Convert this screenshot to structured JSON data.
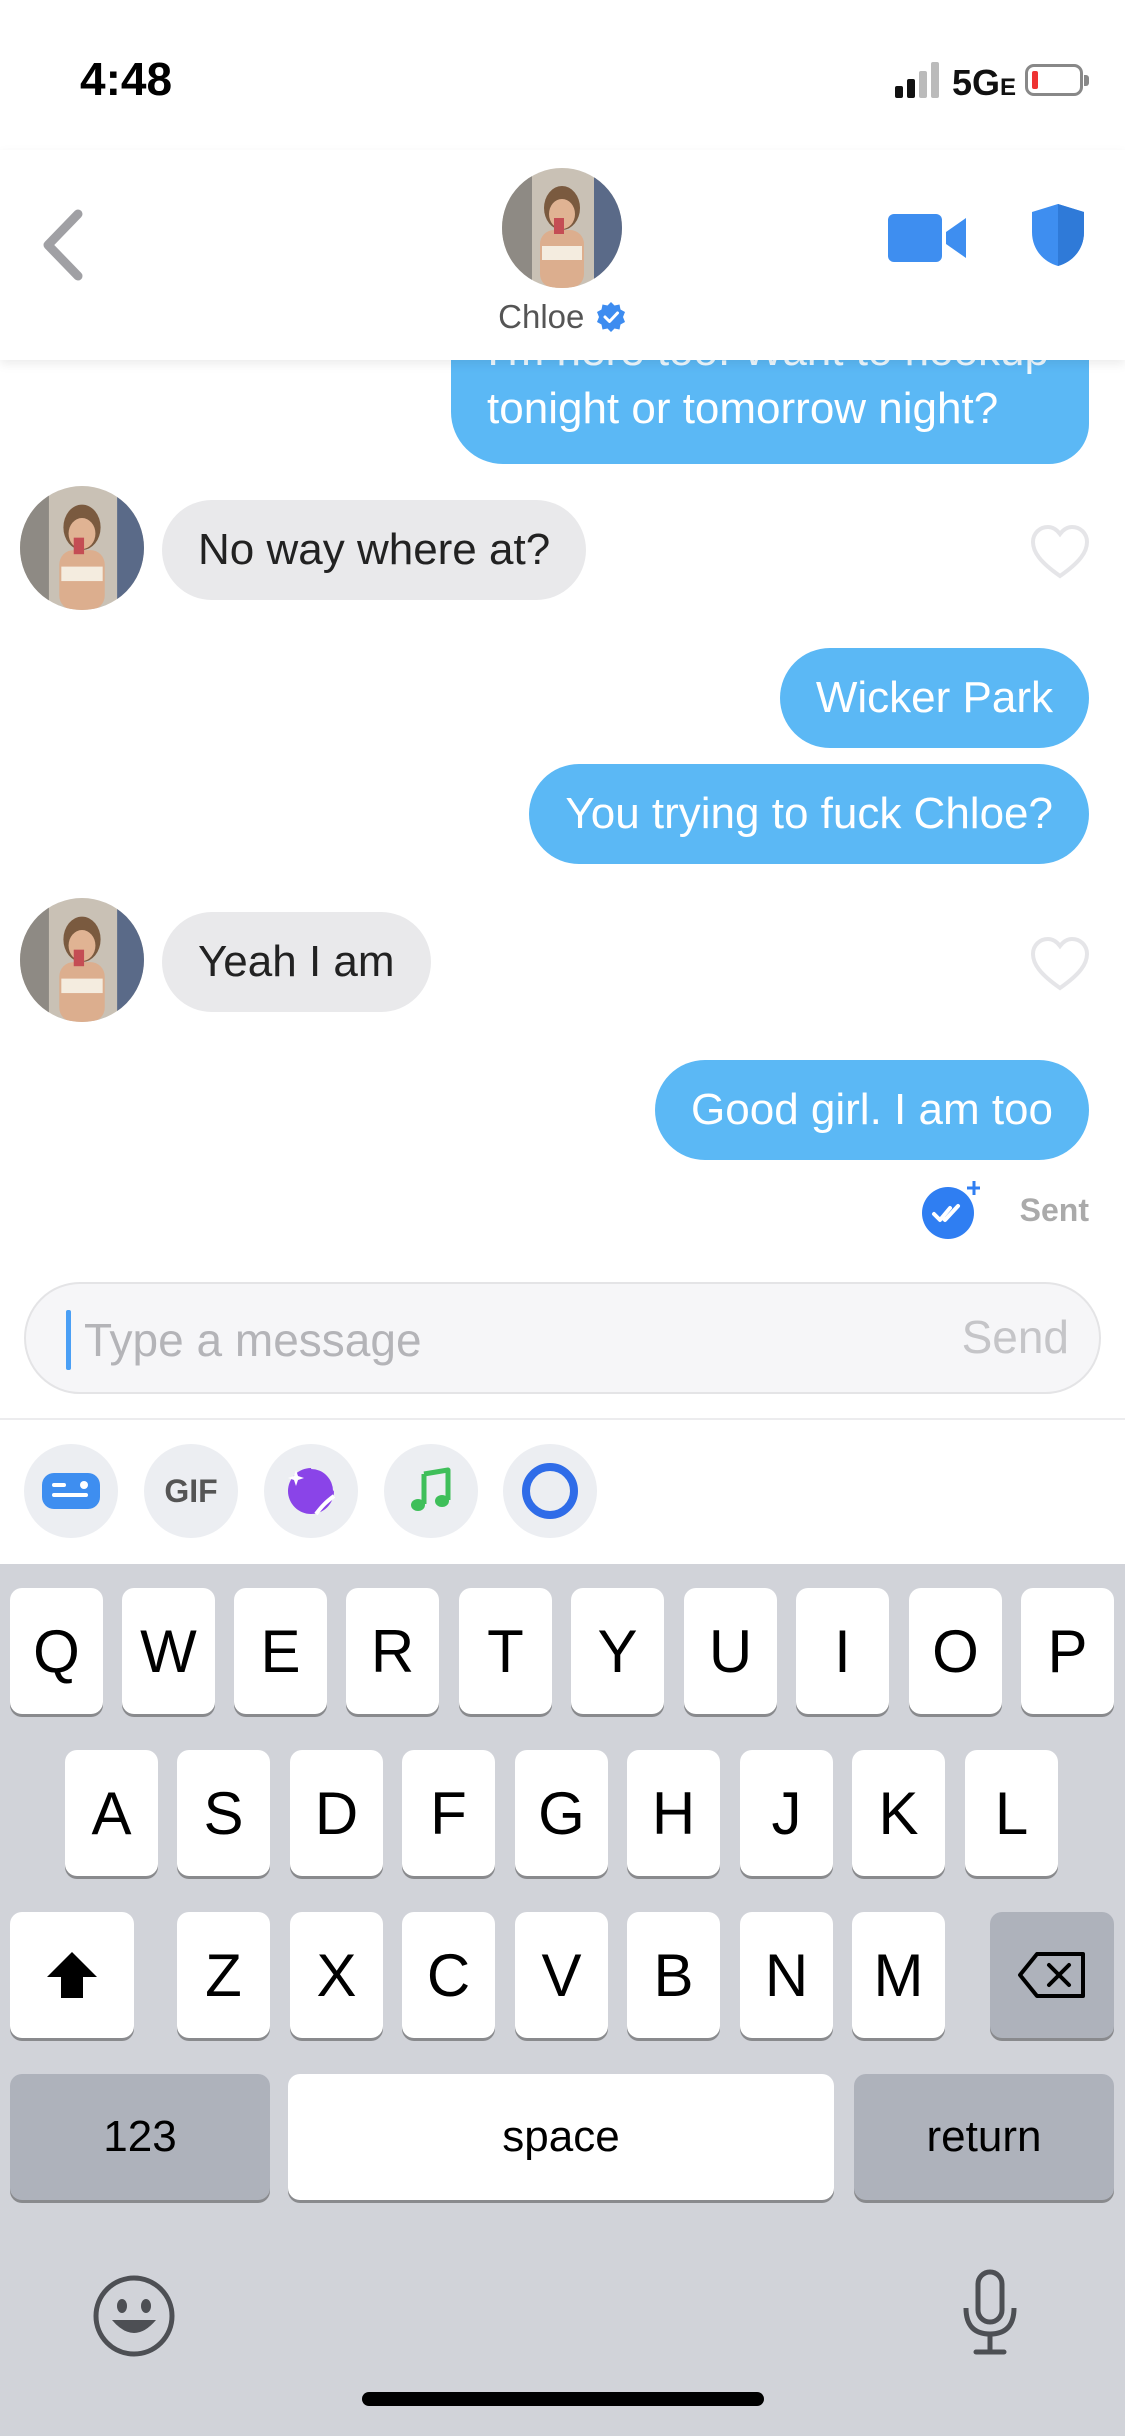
{
  "status_bar": {
    "time": "4:48",
    "network": "5G",
    "network_suffix": "E",
    "battery_icon": "battery-low-icon"
  },
  "header": {
    "back_icon": "chevron-left-icon",
    "contact_name": "Chloe",
    "verified_icon": "verified-badge-icon",
    "video_icon": "video-camera-icon",
    "safety_icon": "shield-icon"
  },
  "messages": [
    {
      "direction": "out",
      "text": "I'm here too. Want to hookup",
      "partial": true
    },
    {
      "direction": "out",
      "text": "tonight or tomorrow night?"
    },
    {
      "direction": "in",
      "text": "No way where at?"
    },
    {
      "direction": "out",
      "text": "Wicker Park"
    },
    {
      "direction": "out",
      "text": "You trying to fuck Chloe?"
    },
    {
      "direction": "in",
      "text": "Yeah I am"
    },
    {
      "direction": "out",
      "text": "Good girl. I am too"
    }
  ],
  "receipt": {
    "label": "Sent",
    "icon": "read-receipt-plus-icon"
  },
  "composer": {
    "placeholder": "Type a message",
    "send_label": "Send"
  },
  "tools": [
    {
      "name": "contact-card-icon"
    },
    {
      "name": "gif-button",
      "label": "GIF"
    },
    {
      "name": "sticker-icon"
    },
    {
      "name": "music-note-icon"
    },
    {
      "name": "ring-icon"
    }
  ],
  "keyboard": {
    "row1": [
      "Q",
      "W",
      "E",
      "R",
      "T",
      "Y",
      "U",
      "I",
      "O",
      "P"
    ],
    "row2": [
      "A",
      "S",
      "D",
      "F",
      "G",
      "H",
      "J",
      "K",
      "L"
    ],
    "row3": [
      "Z",
      "X",
      "C",
      "V",
      "B",
      "N",
      "M"
    ],
    "numbers_label": "123",
    "space_label": "space",
    "return_label": "return",
    "shift_icon": "shift-arrow-icon",
    "delete_icon": "backspace-icon",
    "emoji_icon": "emoji-icon",
    "mic_icon": "microphone-icon"
  },
  "colors": {
    "outgoing_bubble": "#5bb8f5",
    "incoming_bubble": "#e9e9eb",
    "accent": "#4a90e2",
    "keyboard_bg": "#d1d3d9"
  }
}
